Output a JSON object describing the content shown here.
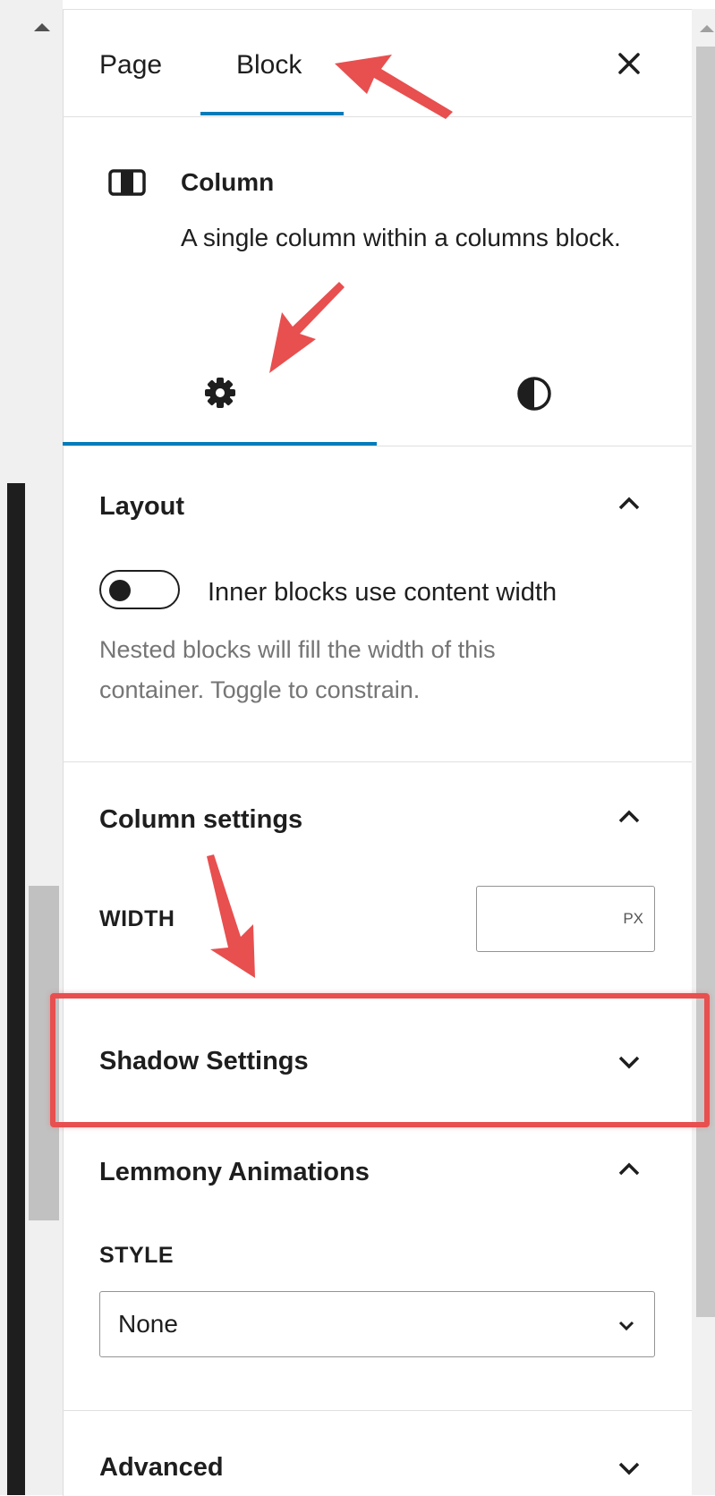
{
  "tabs": [
    {
      "label": "Page",
      "active": false
    },
    {
      "label": "Block",
      "active": true
    }
  ],
  "close_icon": "close-icon",
  "block": {
    "icon": "column-icon",
    "title": "Column",
    "description": "A single column within a columns block."
  },
  "sub_tabs": [
    {
      "icon": "gear-icon",
      "active": true
    },
    {
      "icon": "contrast-icon",
      "active": false
    }
  ],
  "layout": {
    "title": "Layout",
    "toggle_label": "Inner blocks use content width",
    "toggle_on": false,
    "help": "Nested blocks will fill the width of this container. Toggle to constrain."
  },
  "column_settings": {
    "title": "Column settings",
    "width_label": "WIDTH",
    "width_value": "",
    "width_unit": "PX"
  },
  "shadow_settings": {
    "title": "Shadow Settings"
  },
  "animations": {
    "title": "Lemmony Animations",
    "style_label": "STYLE",
    "style_value": "None"
  },
  "advanced": {
    "title": "Advanced"
  },
  "colors": {
    "accent": "#007cba",
    "annotation": "#e84f4f",
    "text": "#1e1e1e",
    "muted": "#757575"
  }
}
